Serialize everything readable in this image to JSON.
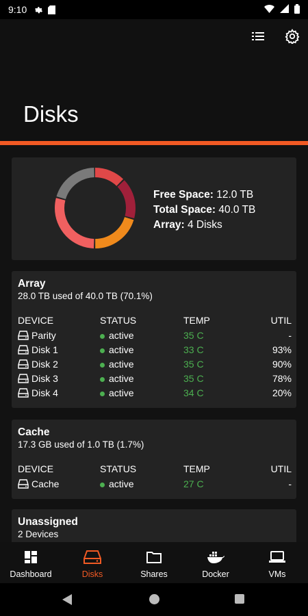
{
  "status_bar": {
    "time": "9:10"
  },
  "app_bar": {
    "title": "Disks"
  },
  "summary": {
    "free_label": "Free Space:",
    "free_value": "12.0 TB",
    "total_label": "Total Space:",
    "total_value": "40.0 TB",
    "array_label": "Array:",
    "array_value": "4 Disks"
  },
  "table_headers": {
    "device": "DEVICE",
    "status": "STATUS",
    "temp": "TEMP",
    "util": "UTIL"
  },
  "array": {
    "title": "Array",
    "usage": "28.0 TB used of 40.0 TB (70.1%)",
    "rows": [
      {
        "device": "Parity",
        "status": "active",
        "temp": "35 C",
        "util": "-"
      },
      {
        "device": "Disk 1",
        "status": "active",
        "temp": "33 C",
        "util": "93%"
      },
      {
        "device": "Disk 2",
        "status": "active",
        "temp": "35 C",
        "util": "90%"
      },
      {
        "device": "Disk 3",
        "status": "active",
        "temp": "35 C",
        "util": "78%"
      },
      {
        "device": "Disk 4",
        "status": "active",
        "temp": "34 C",
        "util": "20%"
      }
    ]
  },
  "cache": {
    "title": "Cache",
    "usage": "17.3 GB used of 1.0 TB (1.7%)",
    "rows": [
      {
        "device": "Cache",
        "status": "active",
        "temp": "27 C",
        "util": "-"
      }
    ]
  },
  "unassigned": {
    "title": "Unassigned",
    "subtitle": "2 Devices"
  },
  "bottom_nav": [
    {
      "label": "Dashboard",
      "icon": "dashboard-icon"
    },
    {
      "label": "Disks",
      "icon": "disk-icon",
      "active": true
    },
    {
      "label": "Shares",
      "icon": "folder-icon"
    },
    {
      "label": "Docker",
      "icon": "docker-icon"
    },
    {
      "label": "VMs",
      "icon": "laptop-icon"
    }
  ],
  "colors": {
    "accent": "#f15a24",
    "active_status": "#4caf50",
    "donut_segments": [
      "#e04848",
      "#a0203a",
      "#f08a1c",
      "#f06060",
      "#7a7a7a"
    ]
  }
}
